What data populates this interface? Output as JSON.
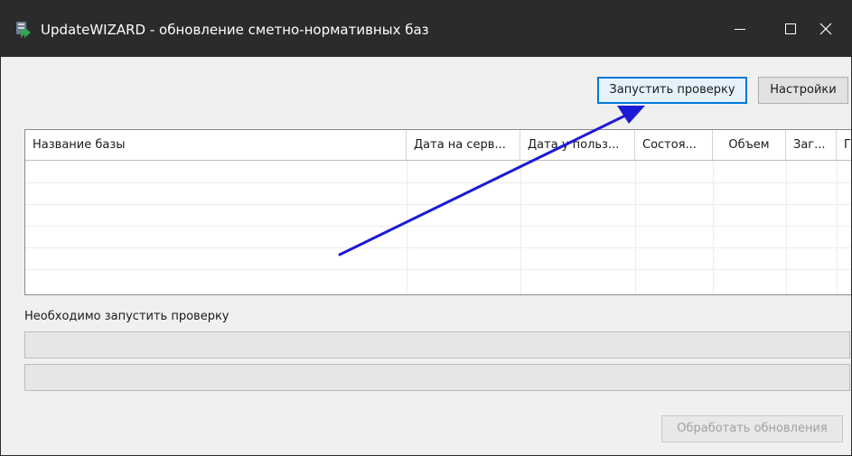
{
  "window": {
    "title": "UpdateWIZARD - обновление сметно-нормативных баз"
  },
  "toolbar": {
    "run_check_label": "Запустить проверку",
    "settings_label": "Настройки"
  },
  "table": {
    "columns": [
      "Название базы",
      "Дата на серв...",
      "Дата у польз...",
      "Состоя...",
      "Объем",
      "Заг...",
      "Г"
    ],
    "rows": []
  },
  "status": {
    "message": "Необходимо запустить проверку"
  },
  "progress": [
    {
      "value": 0
    },
    {
      "value": 0
    }
  ],
  "actions": {
    "process_updates_label": "Обработать обновления"
  },
  "colors": {
    "titlebar": "#2b2b2b",
    "accent": "#0078d7",
    "annotation_arrow": "#1a1ad6"
  }
}
